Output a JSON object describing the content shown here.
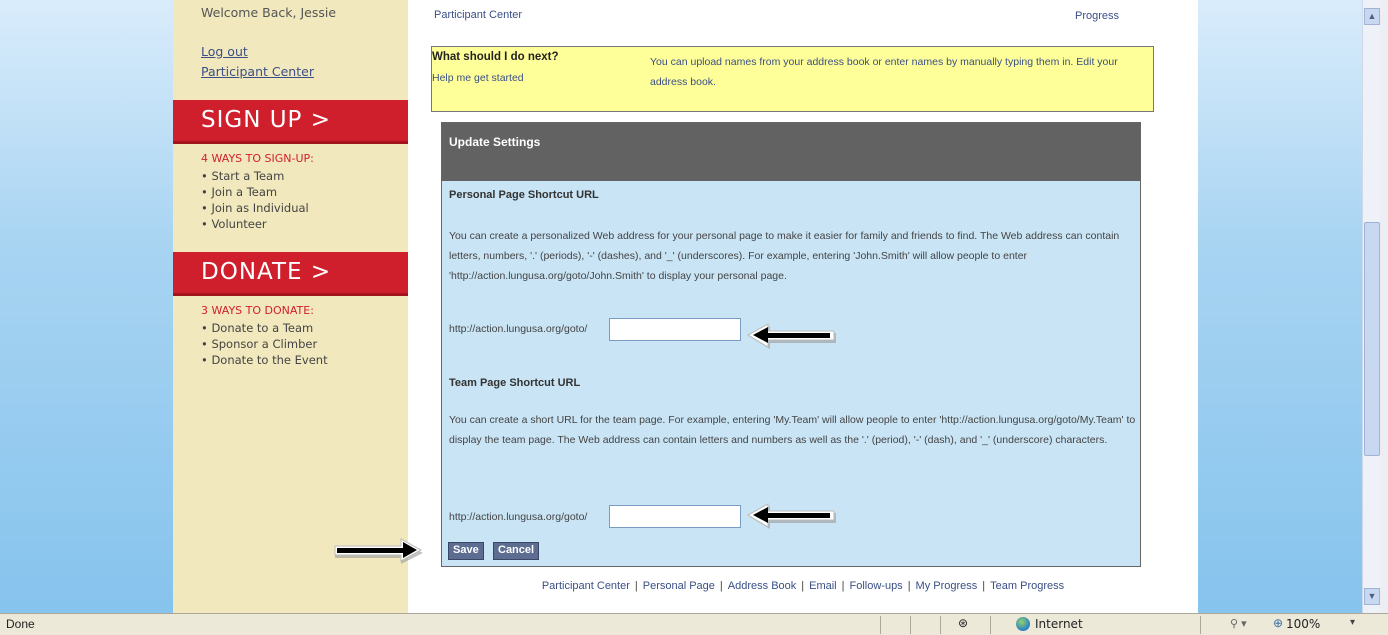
{
  "sidebar": {
    "welcome": "Welcome Back, Jessie",
    "logout": "Log out",
    "participant_center": "Participant Center",
    "signup_banner": "SIGN UP >",
    "signup_heading": "4 WAYS TO SIGN-UP:",
    "signup_items": [
      "Start a Team",
      "Join a Team",
      "Join as Individual",
      "Volunteer"
    ],
    "donate_banner": "DONATE >",
    "donate_heading": "3 WAYS TO DONATE:",
    "donate_items": [
      "Donate to a Team",
      "Sponsor a Climber",
      "Donate to the Event"
    ]
  },
  "topnav": {
    "participant_center": "Participant Center",
    "progress": "Progress"
  },
  "next_box": {
    "question": "What should I do next?",
    "help": "Help me get started",
    "text": "You can upload names from your address book or enter names by manually typing them in. Edit your address book."
  },
  "settings": {
    "title": "Update Settings",
    "personal_title": "Personal Page Shortcut URL",
    "personal_text": "You can create a personalized Web address for your personal page to make it easier for family and friends to find. The Web address can contain letters, numbers, '.' (periods), '-' (dashes), and '_' (underscores). For example, entering 'John.Smith' will allow people to enter 'http://action.lungusa.org/goto/John.Smith' to display your personal page.",
    "url_prefix": "http://action.lungusa.org/goto/",
    "personal_value": "",
    "team_title": "Team Page Shortcut URL",
    "team_text": "You can create a short URL for the team page. For example, entering 'My.Team' will allow people to enter 'http://action.lungusa.org/goto/My.Team' to display the team page. The Web address can contain letters and numbers as well as the '.' (period), '-' (dash), and '_' (underscore) characters.",
    "team_value": "",
    "save": "Save",
    "cancel": "Cancel"
  },
  "footer_links": [
    "Participant Center",
    "Personal Page",
    "Address Book",
    "Email",
    "Follow-ups",
    "My Progress",
    "Team Progress"
  ],
  "statusbar": {
    "status": "Done",
    "zone": "Internet",
    "zoom": "100%"
  },
  "colors": {
    "banner_red": "#d01f2c",
    "sidebar_bg": "#f2e8bd",
    "panel_blue": "#c9e4f5",
    "note_yellow": "#ffff99",
    "header_gray": "#626262"
  }
}
